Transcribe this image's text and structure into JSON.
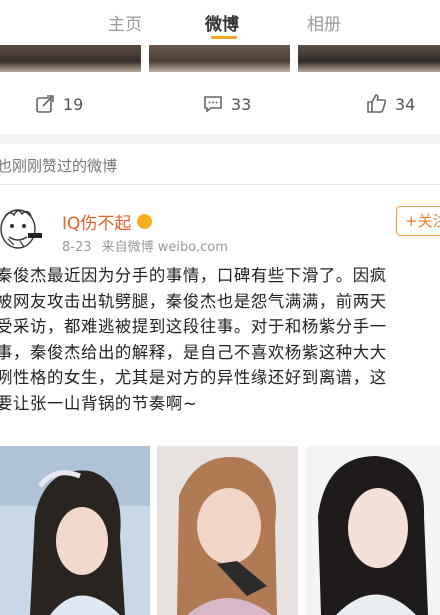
{
  "tabs": [
    "主页",
    "微博",
    "相册"
  ],
  "actions": {
    "repost_count": "19",
    "comment_count": "33",
    "like_count": "34"
  },
  "liked_header": "也刚刚赞过的微博",
  "post": {
    "username": "IQ伤不起",
    "date": "8-23",
    "source": "来自微博 weibo.com",
    "follow_label": "+关注",
    "text_lines": [
      "秦俊杰最近因为分手的事情，口碑有些下滑了。因疯",
      "被网友攻击出轨劈腿，秦俊杰也是怨气满满，前两天",
      "受采访，都难逃被提到这段往事。对于和杨紫分手一",
      "事，秦俊杰给出的解释，是自己不喜欢杨紫这种大大",
      "咧性格的女生，尤其是对方的异性缘还好到离谱，这",
      "要让张一山背锅的节奏啊~"
    ]
  },
  "colors": {
    "accent": "#f5a623",
    "username": "#e8612c",
    "follow": "#e8832c"
  },
  "icons": [
    "repost-icon",
    "comment-icon",
    "like-icon",
    "avatar-meme",
    "user-badge-icon"
  ]
}
